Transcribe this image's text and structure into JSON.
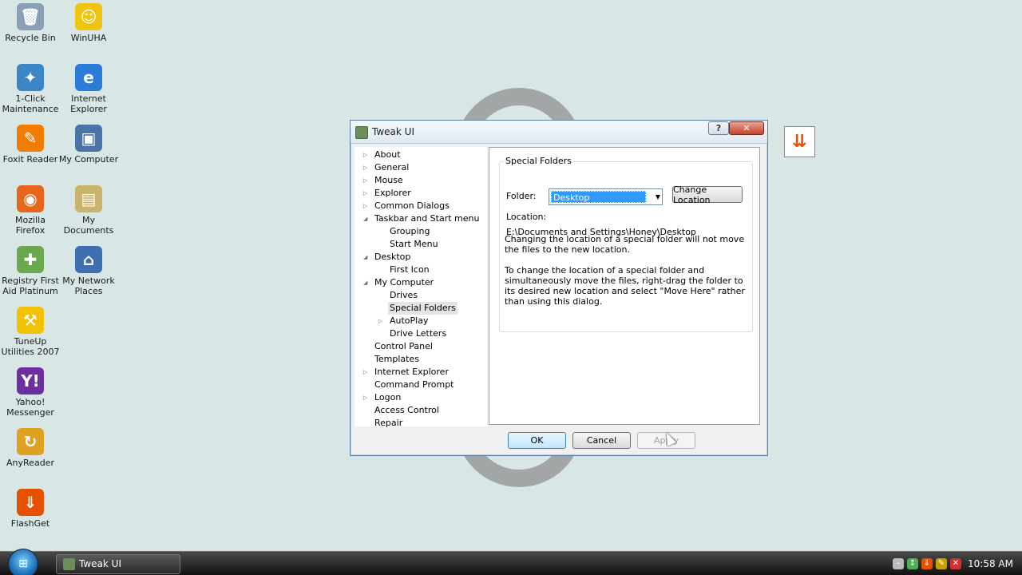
{
  "desktop": {
    "icons": [
      {
        "label": "Recycle Bin",
        "icon": "recycle-bin-icon",
        "color": "#8aa0b5",
        "glyph": "🗑"
      },
      {
        "label": "WinUHA",
        "icon": "winuha-icon",
        "color": "#f1c40f",
        "glyph": "☺"
      },
      {
        "label": "1-Click Maintenance",
        "icon": "maintenance-icon",
        "color": "#3d86c6",
        "glyph": "✦"
      },
      {
        "label": "Internet Explorer",
        "icon": "internet-explorer-icon",
        "color": "#2b7bd8",
        "glyph": "e"
      },
      {
        "label": "Foxit Reader",
        "icon": "foxit-reader-icon",
        "color": "#f07d00",
        "glyph": "✎"
      },
      {
        "label": "My Computer",
        "icon": "my-computer-icon",
        "color": "#4a73a8",
        "glyph": "▣"
      },
      {
        "label": "Mozilla Firefox",
        "icon": "firefox-icon",
        "color": "#e8661c",
        "glyph": "◉"
      },
      {
        "label": "My Documents",
        "icon": "my-documents-icon",
        "color": "#c9b46b",
        "glyph": "▤"
      },
      {
        "label": "Registry First Aid Platinum",
        "icon": "registry-first-aid-icon",
        "color": "#6aa84f",
        "glyph": "✚"
      },
      {
        "label": "My Network Places",
        "icon": "network-places-icon",
        "color": "#3f6fb0",
        "glyph": "⌂"
      },
      {
        "label": "TuneUp Utilities 2007",
        "icon": "tuneup-icon",
        "color": "#f2c200",
        "glyph": "⚒"
      },
      {
        "label": "Yahoo! Messenger",
        "icon": "yahoo-messenger-icon",
        "color": "#6c2f9e",
        "glyph": "Y!"
      },
      {
        "label": "AnyReader",
        "icon": "anyreader-icon",
        "color": "#e0a020",
        "glyph": "↻"
      },
      {
        "label": "FlashGet",
        "icon": "flashget-icon",
        "color": "#e65100",
        "glyph": "⇓"
      }
    ]
  },
  "dialog": {
    "title": "Tweak UI",
    "help_label": "?",
    "close_label": "✕",
    "tree": [
      {
        "label": "About",
        "level": 0,
        "arrow": "▷"
      },
      {
        "label": "General",
        "level": 0,
        "arrow": "▷"
      },
      {
        "label": "Mouse",
        "level": 0,
        "arrow": "▷"
      },
      {
        "label": "Explorer",
        "level": 0,
        "arrow": "▷"
      },
      {
        "label": "Common Dialogs",
        "level": 0,
        "arrow": "▷"
      },
      {
        "label": "Taskbar and Start menu",
        "level": 0,
        "arrow": "◢"
      },
      {
        "label": "Grouping",
        "level": 1,
        "arrow": ""
      },
      {
        "label": "Start Menu",
        "level": 1,
        "arrow": ""
      },
      {
        "label": "Desktop",
        "level": 0,
        "arrow": "◢"
      },
      {
        "label": "First Icon",
        "level": 1,
        "arrow": ""
      },
      {
        "label": "My Computer",
        "level": 0,
        "arrow": "◢"
      },
      {
        "label": "Drives",
        "level": 1,
        "arrow": ""
      },
      {
        "label": "Special Folders",
        "level": 1,
        "arrow": "",
        "selected": true
      },
      {
        "label": "AutoPlay",
        "level": 1,
        "arrow": "▷"
      },
      {
        "label": "Drive Letters",
        "level": 1,
        "arrow": ""
      },
      {
        "label": "Control Panel",
        "level": 0,
        "arrow": ""
      },
      {
        "label": "Templates",
        "level": 0,
        "arrow": ""
      },
      {
        "label": "Internet Explorer",
        "level": 0,
        "arrow": "▷"
      },
      {
        "label": "Command Prompt",
        "level": 0,
        "arrow": ""
      },
      {
        "label": "Logon",
        "level": 0,
        "arrow": "▷"
      },
      {
        "label": "Access Control",
        "level": 0,
        "arrow": ""
      },
      {
        "label": "Repair",
        "level": 0,
        "arrow": ""
      }
    ],
    "panel": {
      "group_title": "Special Folders",
      "folder_label": "Folder:",
      "folder_value": "Desktop",
      "change_location_label": "Change Location",
      "location_label": "Location:",
      "location_value": "E:\\Documents and Settings\\Honey\\Desktop",
      "note1": "Changing the location of a special folder will not move the files to the new location.",
      "note2": "To change the location of a special folder and simultaneously move the files, right-drag the folder to its desired new location and select \"Move Here\" rather than using this dialog."
    },
    "buttons": {
      "ok": "OK",
      "cancel": "Cancel",
      "apply": "Apply"
    }
  },
  "taskbar": {
    "task_label": "Tweak UI",
    "clock": "10:58 AM",
    "tray": [
      {
        "icon": "tray-minus-icon",
        "color": "#bbbbbb",
        "glyph": "–"
      },
      {
        "icon": "tray-network-icon",
        "color": "#4caf50",
        "glyph": "↕"
      },
      {
        "icon": "tray-flashget-icon",
        "color": "#e65100",
        "glyph": "⇓"
      },
      {
        "icon": "tray-utility-icon",
        "color": "#c8a000",
        "glyph": "✎"
      },
      {
        "icon": "tray-stop-icon",
        "color": "#d32f2f",
        "glyph": "✕"
      }
    ]
  }
}
